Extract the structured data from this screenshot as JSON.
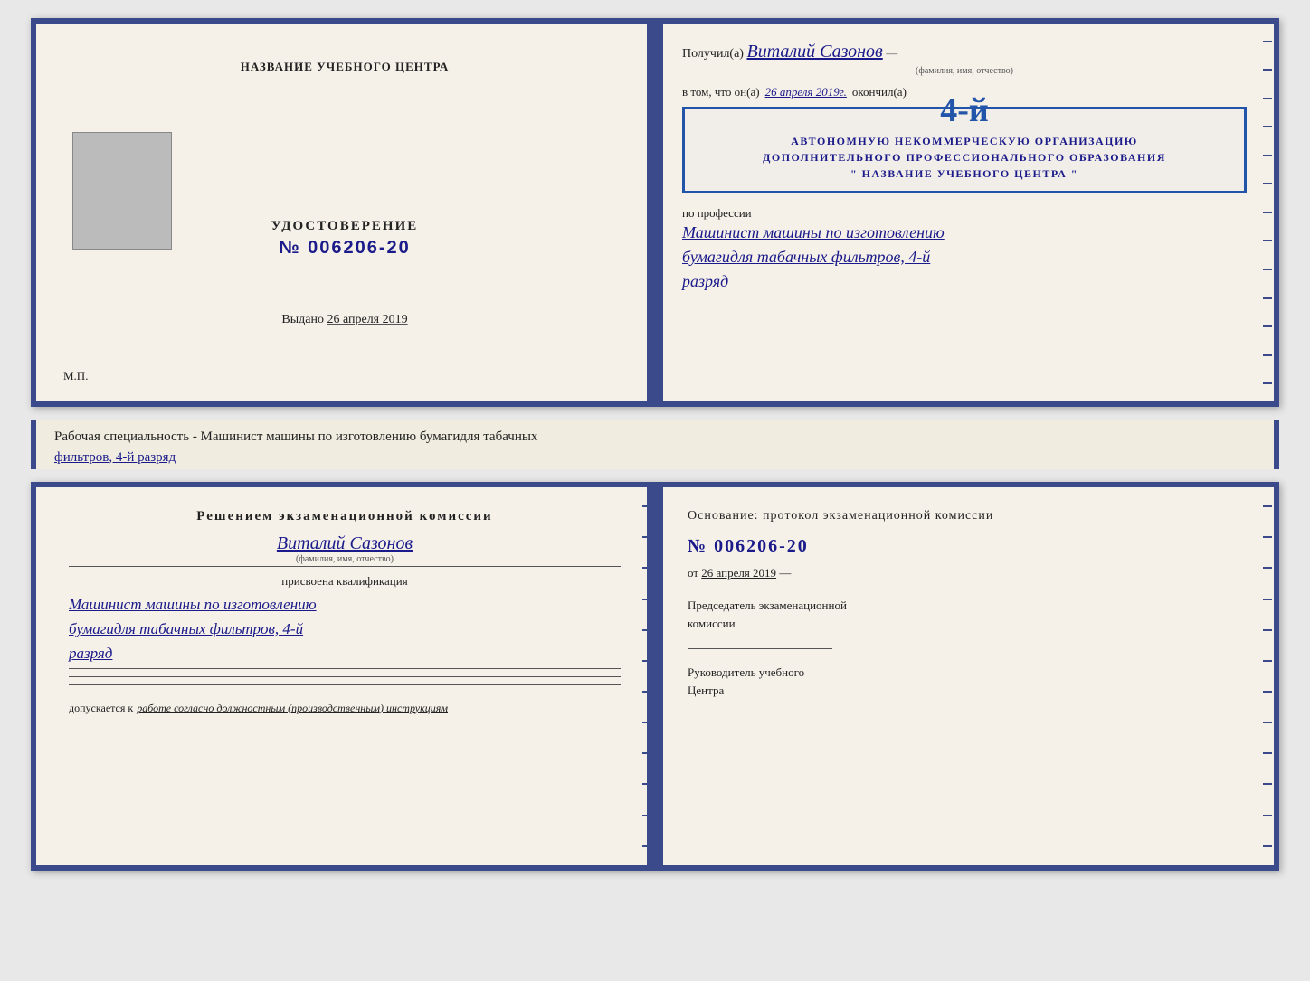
{
  "topDiploma": {
    "left": {
      "title": "НАЗВАНИЕ УЧЕБНОГО ЦЕНТРА",
      "certLabel": "УДОСТОВЕРЕНИЕ",
      "certNumber": "№ 006206-20",
      "issuedLabel": "Выдано",
      "issuedDate": "26 апреля 2019",
      "mpLabel": "М.П."
    },
    "right": {
      "recipientPrefix": "Получил(а)",
      "recipientName": "Виталий Сазонов",
      "recipientSub": "(фамилия, имя, отчество)",
      "dateLine": "в том, что он(а)",
      "dateValue": "26 апреля 2019г.",
      "finishedLabel": "окончил(а)",
      "stampNumber": "4-й",
      "stampLine1": "АВТОНОМНУЮ НЕКОММЕРЧЕСКУЮ ОРГАНИЗАЦИЮ",
      "stampLine2": "ДОПОЛНИТЕЛЬНОГО ПРОФЕССИОНАЛЬНОГО ОБРАЗОВАНИЯ",
      "stampLine3": "\" НАЗВАНИЕ УЧЕБНОГО ЦЕНТРА \"",
      "professionLabel": "по профессии",
      "professionLine1": "Машинист машины по изготовлению",
      "professionLine2": "бумагидля табачных фильтров, 4-й",
      "professionLine3": "разряд"
    }
  },
  "infoBar": {
    "textPrefix": "Рабочая специальность - Машинист машины по изготовлению бумагидля табачных",
    "textUnderline": "фильтров, 4-й разряд"
  },
  "bottomCert": {
    "left": {
      "title": "Решением экзаменационной комиссии",
      "name": "Виталий Сазонов",
      "nameSub": "(фамилия, имя, отчество)",
      "assignedLabel": "присвоена квалификация",
      "profLine1": "Машинист машины по изготовлению",
      "profLine2": "бумагидля табачных фильтров, 4-й",
      "profLine3": "разряд",
      "admittedPrefix": "допускается к",
      "admittedValue": "работе согласно должностным (производственным) инструкциям"
    },
    "right": {
      "basisLabel": "Основание: протокол экзаменационной комиссии",
      "number": "№  006206-20",
      "fromLabel": "от",
      "fromDate": "26 апреля 2019",
      "chairmanLine1": "Председатель экзаменационной",
      "chairmanLine2": "комиссии",
      "directorLine1": "Руководитель учебного",
      "directorLine2": "Центра"
    }
  }
}
